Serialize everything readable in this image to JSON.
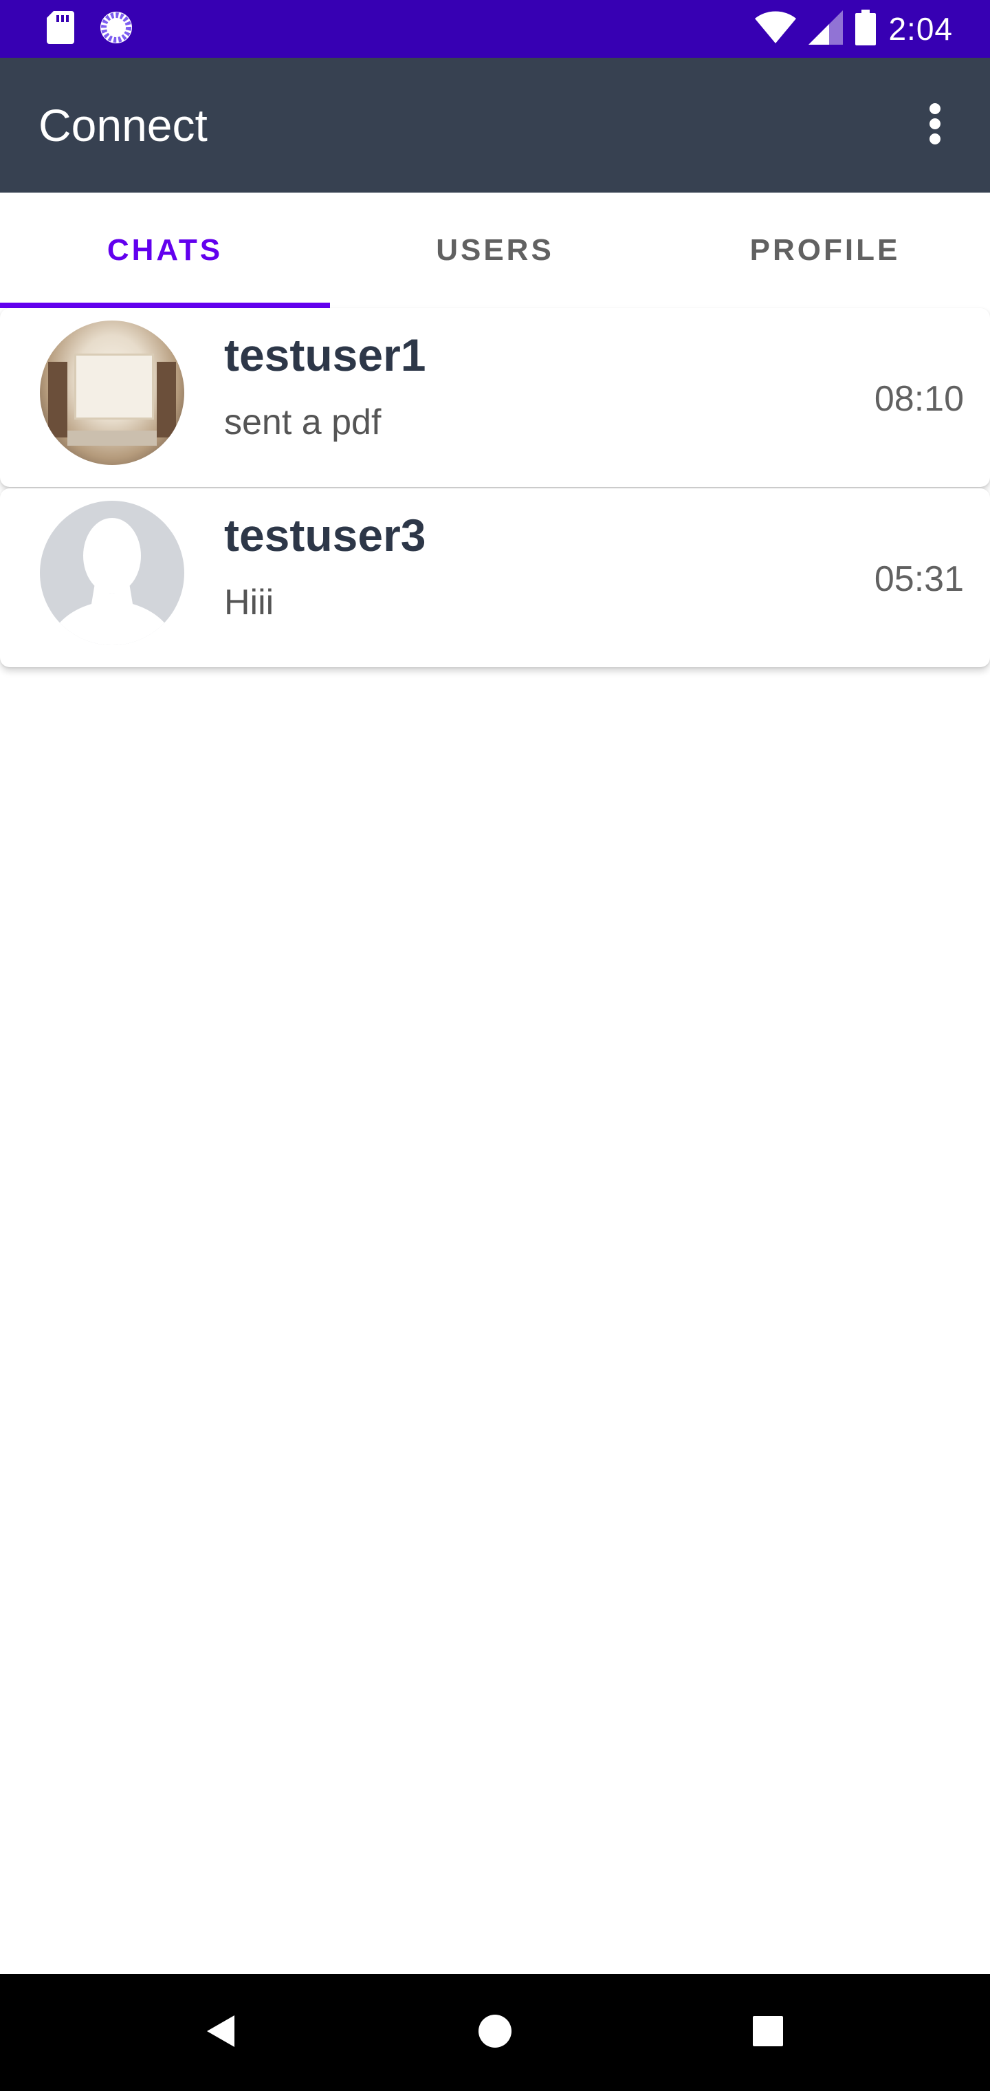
{
  "status_bar": {
    "time": "2:04",
    "icons": [
      "sd-card-icon",
      "sync-icon",
      "wifi-icon",
      "signal-icon",
      "battery-icon"
    ]
  },
  "app_bar": {
    "title": "Connect",
    "menu_icon": "more-vert-icon"
  },
  "tabs": [
    {
      "label": "CHATS",
      "active": true
    },
    {
      "label": "USERS",
      "active": false
    },
    {
      "label": "PROFILE",
      "active": false
    }
  ],
  "chats": [
    {
      "name": "testuser1",
      "preview": "sent a pdf",
      "time": "08:10",
      "avatar": "photo"
    },
    {
      "name": "testuser3",
      "preview": "Hiii",
      "time": "05:31",
      "avatar": "default-person-icon"
    }
  ],
  "nav_bar": {
    "buttons": [
      "back-icon",
      "home-icon",
      "recents-icon"
    ]
  },
  "colors": {
    "status_bar": "#3700b3",
    "app_bar": "#374151",
    "accent": "#6200ee",
    "name_text": "#2d3748"
  }
}
